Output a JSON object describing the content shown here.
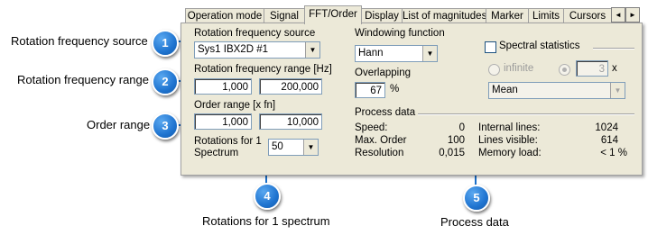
{
  "callouts": [
    {
      "number": "1",
      "label": "Rotation frequency source"
    },
    {
      "number": "2",
      "label": "Rotation frequency range"
    },
    {
      "number": "3",
      "label": "Order range"
    },
    {
      "number": "4",
      "label": "Rotations for 1 spectrum"
    },
    {
      "number": "5",
      "label": "Process data"
    }
  ],
  "tabs": [
    "Operation mode",
    "Signal",
    "FFT/Order",
    "Display",
    "List of magnitudes",
    "Marker",
    "Limits",
    "Cursors"
  ],
  "active_tab": "FFT/Order",
  "scroll_left_glyph": "◄",
  "scroll_right_glyph": "►",
  "rotation_source": {
    "label": "Rotation frequency source",
    "value": "Sys1 IBX2D #1"
  },
  "rotation_range": {
    "label": "Rotation  frequency range [Hz]",
    "min": "1,000",
    "max": "200,000"
  },
  "order_range": {
    "label": "Order range [x fn]",
    "min": "1,000",
    "max": "10,000"
  },
  "rotations_per_spectrum": {
    "label_line1": "Rotations for 1",
    "label_line2": "Spectrum",
    "value": "50"
  },
  "windowing": {
    "label": "Windowing function",
    "value": "Hann"
  },
  "overlapping": {
    "label": "Overlapping",
    "value": "67",
    "unit": "%"
  },
  "spectral_statistics": {
    "label": "Spectral statistics",
    "checked": false,
    "infinite_label": "infinite",
    "count_value": "3",
    "count_unit": "x",
    "mode": "Mean"
  },
  "process_data": {
    "title": "Process data",
    "left": [
      {
        "label": "Speed:",
        "value": "0"
      },
      {
        "label": "Max. Order",
        "value": "100"
      },
      {
        "label": "Resolution",
        "value": "0,015"
      }
    ],
    "right": [
      {
        "label": "Internal lines:",
        "value": "1024"
      },
      {
        "label": "Lines visible:",
        "value": "614"
      },
      {
        "label": "Memory load:",
        "value": "< 1 %"
      }
    ]
  },
  "dropdown_glyph": "▼",
  "colors": {
    "badge": "#1f74d0",
    "panel": "#ece9d8",
    "connector": "#1a6fc9"
  }
}
